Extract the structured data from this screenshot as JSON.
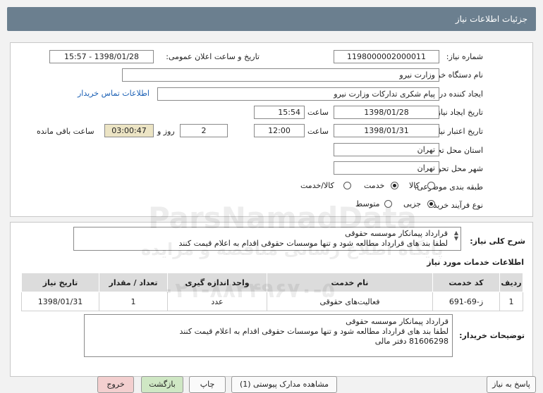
{
  "header": {
    "title": "جزئیات اطلاعات نیاز"
  },
  "form": {
    "need_number_label": "شماره نیاز:",
    "need_number": "1198000002000011",
    "announce_label": "تاریخ و ساعت اعلان عمومی:",
    "announce_value": "1398/01/28 - 15:57",
    "buyer_org_label": "نام دستگاه خریدار:",
    "buyer_org": "وزارت نیرو",
    "requester_label": "ایجاد کننده درخواست:",
    "requester": "پیام شکری تدارکات وزارت نیرو",
    "contact_link": "اطلاعات تماس خریدار",
    "created_label": "تاریخ ایجاد نیاز:",
    "created_date": "1398/01/28",
    "time_label": "ساعت",
    "created_time": "15:54",
    "validity_label": "تاریخ اعتبار نیاز:",
    "validity_date": "1398/01/31",
    "validity_time": "12:00",
    "days_value": "2",
    "days_label": "روز و",
    "remaining_value": "03:00:47",
    "remaining_label": "ساعت باقی مانده",
    "province_label": "استان محل تحویل:",
    "province": "تهران",
    "city_label": "شهر محل تحویل:",
    "city": "تهران",
    "category_label": "طبقه بندی موضوعی:",
    "category_options": [
      "کالا",
      "خدمت",
      "کالا/خدمت"
    ],
    "category_selected": "خدمت",
    "process_label": "نوع فرآیند خرید :",
    "process_options": [
      "جزیی",
      "متوسط"
    ],
    "process_selected": "جزیی"
  },
  "general": {
    "label": "شرح کلی نیاز:",
    "line1": "قرارداد پیمانکار موسسه حقوقی",
    "line2": "لطفا بند های قرارداد مطالعه شود و تنها موسسات حقوقی اقدام به اعلام قیمت کنند"
  },
  "services": {
    "title": "اطلاعات خدمات مورد نیاز",
    "columns": [
      "ردیف",
      "کد خدمت",
      "نام خدمت",
      "واحد اندازه گیری",
      "تعداد / مقدار",
      "تاریخ نیاز"
    ],
    "rows": [
      [
        "1",
        "ز-69-691",
        "فعالیت‌های حقوقی",
        "عدد",
        "1",
        "1398/01/31"
      ]
    ]
  },
  "buyer_notes": {
    "label": "توضیحات خریدار:",
    "line1": "قرارداد پیمانکار موسسه حقوقی",
    "line2": "لطفا بند های قرارداد مطالعه شود و تنها موسسات حقوقی اقدام به اعلام قیمت کنند",
    "line3": "81606298 دفتر مالی"
  },
  "buttons": {
    "reply": "پاسخ به نیاز",
    "view_docs": "مشاهده مدارک پیوستی (1)",
    "print": "چاپ",
    "back": "بازگشت",
    "exit": "خروج"
  },
  "watermark": {
    "brand": "ParsNamadData",
    "line1": "پایگاه اطلاع رسانی مناقصه و مزایده",
    "line2": "۰۲۱-۸۸۳۴۹۶۷۰-۵"
  }
}
